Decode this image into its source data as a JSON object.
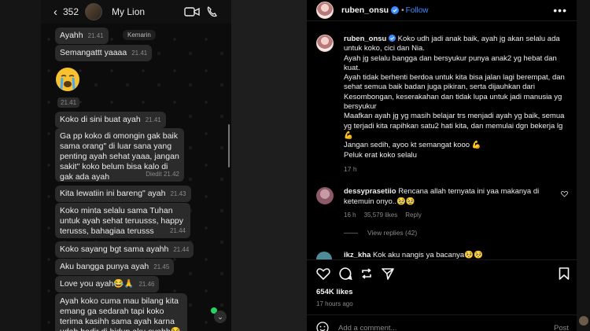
{
  "whatsapp": {
    "header": {
      "back_icon": "chevron-left-icon",
      "unread_count": "352",
      "contact_name": "My Lion"
    },
    "date_chip": "Kemarin",
    "messages": [
      {
        "text": "Ayahh",
        "time": "21.41"
      },
      {
        "text": "Semangattt yaaaa",
        "time": "21.41"
      },
      {
        "emoji": "😭",
        "time": "21.41"
      },
      {
        "text": "Koko di sini buat ayah",
        "time": "21.41"
      },
      {
        "text": "Ga pp koko di omongin gak baik sama orang\" di luar sana yang penting ayah sehat yaaa, jangan sakit\" koko belum bisa kalo di gak ada ayah",
        "edited": "Diedit",
        "time": "21.42"
      },
      {
        "text": "Kita lewatiin ini bareng\" ayah",
        "time": "21.43"
      },
      {
        "text": "Koko minta selalu sama Tuhan untuk ayah sehat teruusss, happy terusss, bahagiaa terusss",
        "time": "21.44"
      },
      {
        "text": "Koko sayang bgt sama ayahh",
        "time": "21.44"
      },
      {
        "text": "Aku bangga punya ayah",
        "time": "21.45"
      },
      {
        "text": "Love you ayah😂🙏",
        "time": "21.46"
      },
      {
        "text": "Ayah koko cuma mau bilang kita emang ga sedarah tapi koko terima kasihh sama ayah karna udah hadir di hidup aku ayahh😂"
      }
    ]
  },
  "instagram": {
    "username": "ruben_onsu",
    "follow_label": "Follow",
    "caption_lines": [
      "Koko udh jadi anak baik, ayah jg akan selalu ada untuk koko, cici dan Nia.",
      "Ayah jg selalu bangga dan bersyukur punya anak2 yg hebat dan kuat.",
      "Ayah tidak berhenti berdoa untuk kita bisa jalan lagi berempat, dan sehat semua baik badan juga pikiran, serta dijauhkan dari Kesombongan, keserakahan dan tidak lupa untuk jadi manusia yg bersyukur",
      "Maafkan ayah jg yg masih belajar trs menjadi ayah yg baik, semua yg terjadi kita rapihkan satu2 hati kita, dan memulai dgn bekerja lg 💪",
      "Jangan sedih, ayoo kt semangat kooo 💪",
      "Peluk erat koko selalu"
    ],
    "caption_time": "17 h",
    "comment": {
      "username": "dessyprasetiio",
      "text": "Rencana allah ternyata ini yaa makanya di ketemuin onyo..🥹🥹",
      "time": "16 h",
      "likes": "35,579 likes",
      "reply_label": "Reply",
      "view_replies": "View replies (42)"
    },
    "comment2": {
      "username": "ikz_kha",
      "text": "Kok aku nangis ya bacanya🥺🥺"
    },
    "likes_total": "654K likes",
    "posted_ago": "17 hours ago",
    "add_comment_placeholder": "Add a comment...",
    "post_label": "Post"
  }
}
